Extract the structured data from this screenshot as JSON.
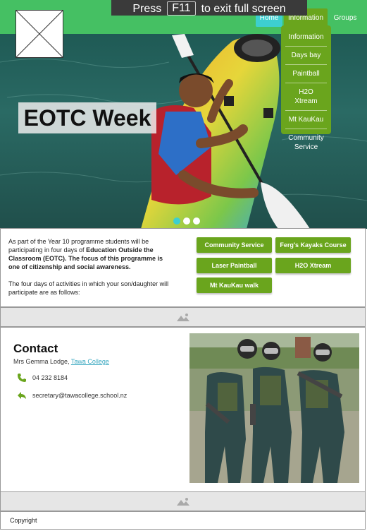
{
  "fullscreen_banner": {
    "before": "Press",
    "key": "F11",
    "after": "to exit full screen"
  },
  "nav": {
    "home": "Home",
    "information": "Information",
    "groups": "Groups"
  },
  "dropdown": [
    "Information",
    "Days bay",
    "Paintball",
    "H2O Xtream",
    "Mt KauKau",
    "Community Service"
  ],
  "hero": {
    "title": "EOTC Week",
    "slides": 3,
    "active_slide": 1
  },
  "intro": {
    "p1_start": "As part of the Year 10 programme students will be participating in four days of ",
    "p1_bold": "Education Outside the Classroom (EOTC). The focus of this programme is one of citizenship and social awareness.",
    "p2": "The four days of activities in which your son/daughter will participate are as follows:"
  },
  "buttons": [
    "Community Service",
    "Ferg's Kayaks Course",
    "Laser Paintball",
    "H2O Xtream",
    "Mt KauKau walk"
  ],
  "contact": {
    "title": "Contact",
    "name": "Mrs Gemma Lodge, ",
    "school": "Tawa College",
    "phone": "04 232 8184",
    "email": "secretary@tawacollege.school.nz"
  },
  "footer": {
    "text": "Copyright"
  },
  "colors": {
    "header": "#45c063",
    "accent_green": "#6aa51d",
    "accent_teal": "#3dcfcf"
  }
}
